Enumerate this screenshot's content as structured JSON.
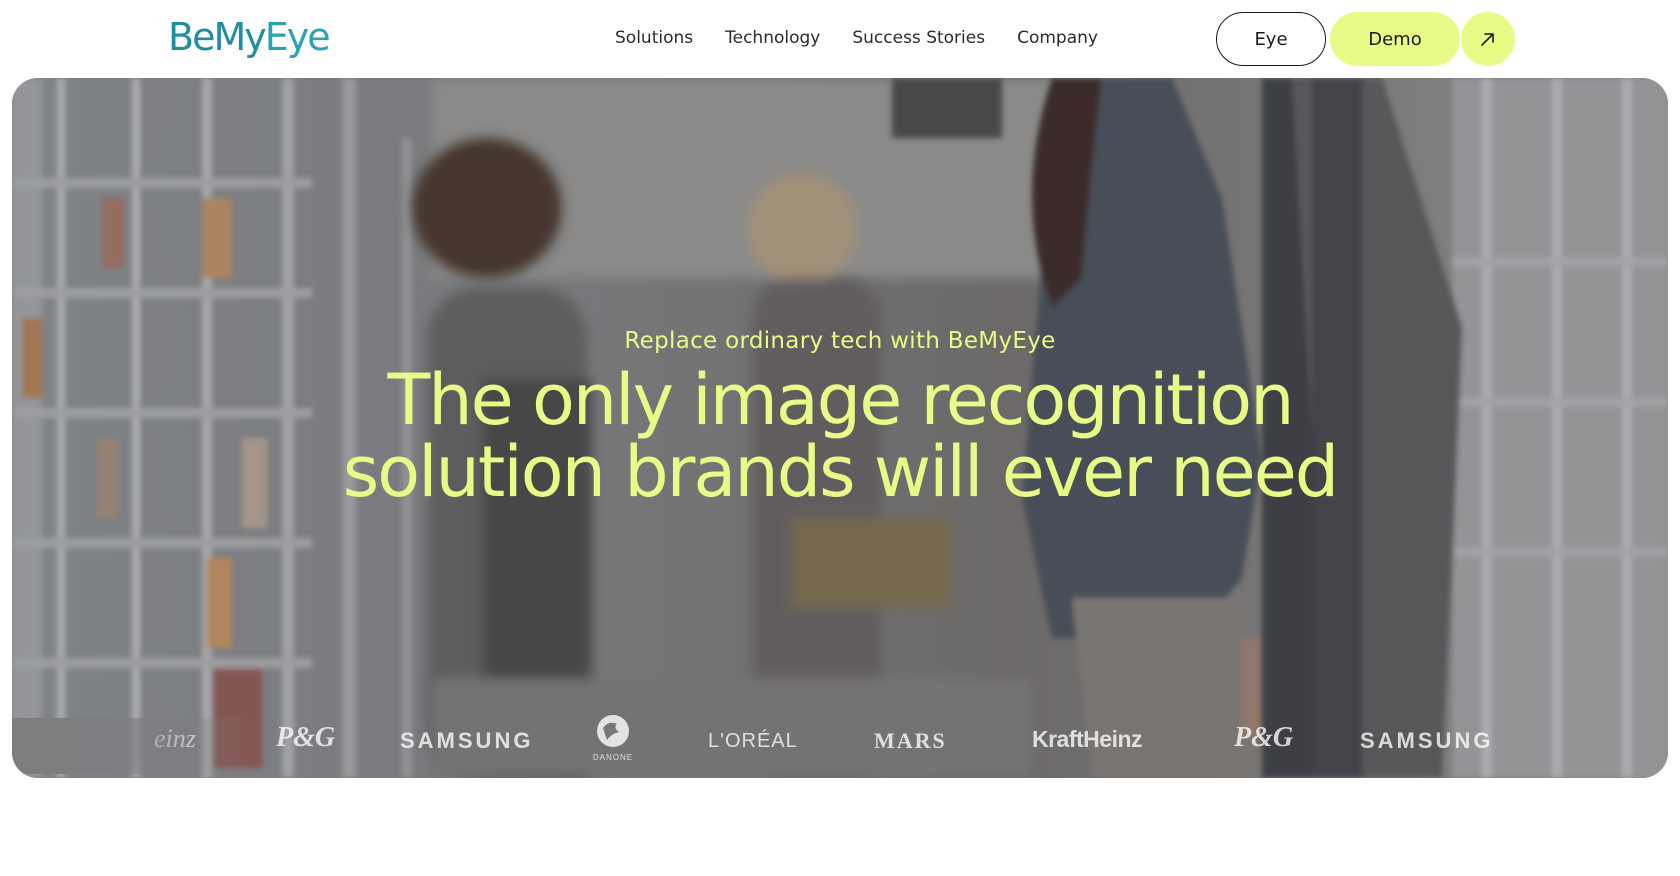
{
  "brand": {
    "logo_part1": "Be",
    "logo_part2": "My",
    "logo_part3": "Eye"
  },
  "nav": {
    "items": [
      {
        "label": "Solutions"
      },
      {
        "label": "Technology"
      },
      {
        "label": "Success Stories"
      },
      {
        "label": "Company"
      }
    ],
    "eye_button": "Eye",
    "demo_button": "Demo",
    "arrow_icon": "arrow-up-right-icon"
  },
  "hero": {
    "eyebrow": "Replace ordinary tech with BeMyEye",
    "headline_line1": "The only image recognition",
    "headline_line2": "solution brands will ever need"
  },
  "client_logos": {
    "items": [
      {
        "name": "Heinz",
        "text": "einz"
      },
      {
        "name": "P&G",
        "text": "P&G"
      },
      {
        "name": "Samsung",
        "text": "SAMSUNG"
      },
      {
        "name": "Danone",
        "text": "DANONE"
      },
      {
        "name": "L'Oréal",
        "text": "L'ORÉAL"
      },
      {
        "name": "Mars",
        "text": "MARS"
      },
      {
        "name": "Kraft Heinz",
        "text": "KraftHeinz"
      },
      {
        "name": "P&G",
        "text": "P&G"
      },
      {
        "name": "Samsung",
        "text": "SAMSUNG"
      }
    ]
  },
  "colors": {
    "accent": "#e8fb86",
    "brand_teal": "#1f8f9e",
    "text_dark": "#2b2b2b"
  }
}
